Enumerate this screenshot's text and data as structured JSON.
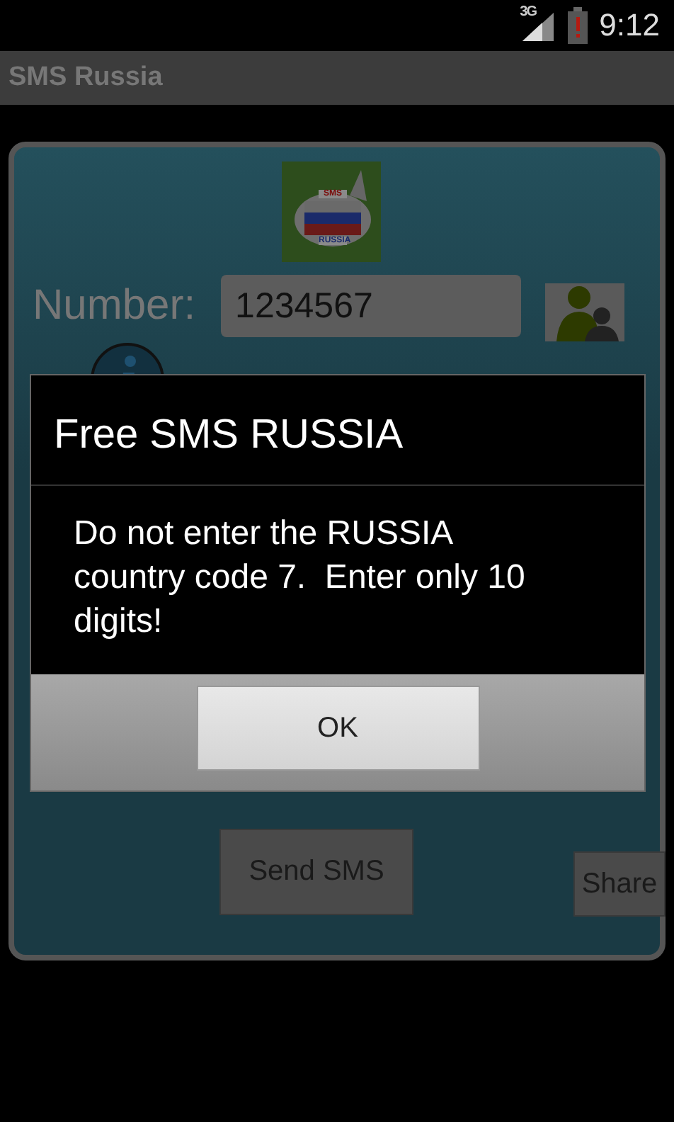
{
  "status_bar": {
    "network": "3G",
    "time": "9:12"
  },
  "app_bar": {
    "title": "SMS Russia"
  },
  "form": {
    "logo": {
      "top": "SMS",
      "bottom": "RUSSIA"
    },
    "number_label": "Number:",
    "number_value": "1234567",
    "send_button": "Send SMS",
    "share_button": "Share"
  },
  "dialog": {
    "title": "Free SMS RUSSIA",
    "message": "Do not enter the RUSSIA country code 7.  Enter only 10 digits!",
    "buttons": [
      "OK"
    ]
  }
}
